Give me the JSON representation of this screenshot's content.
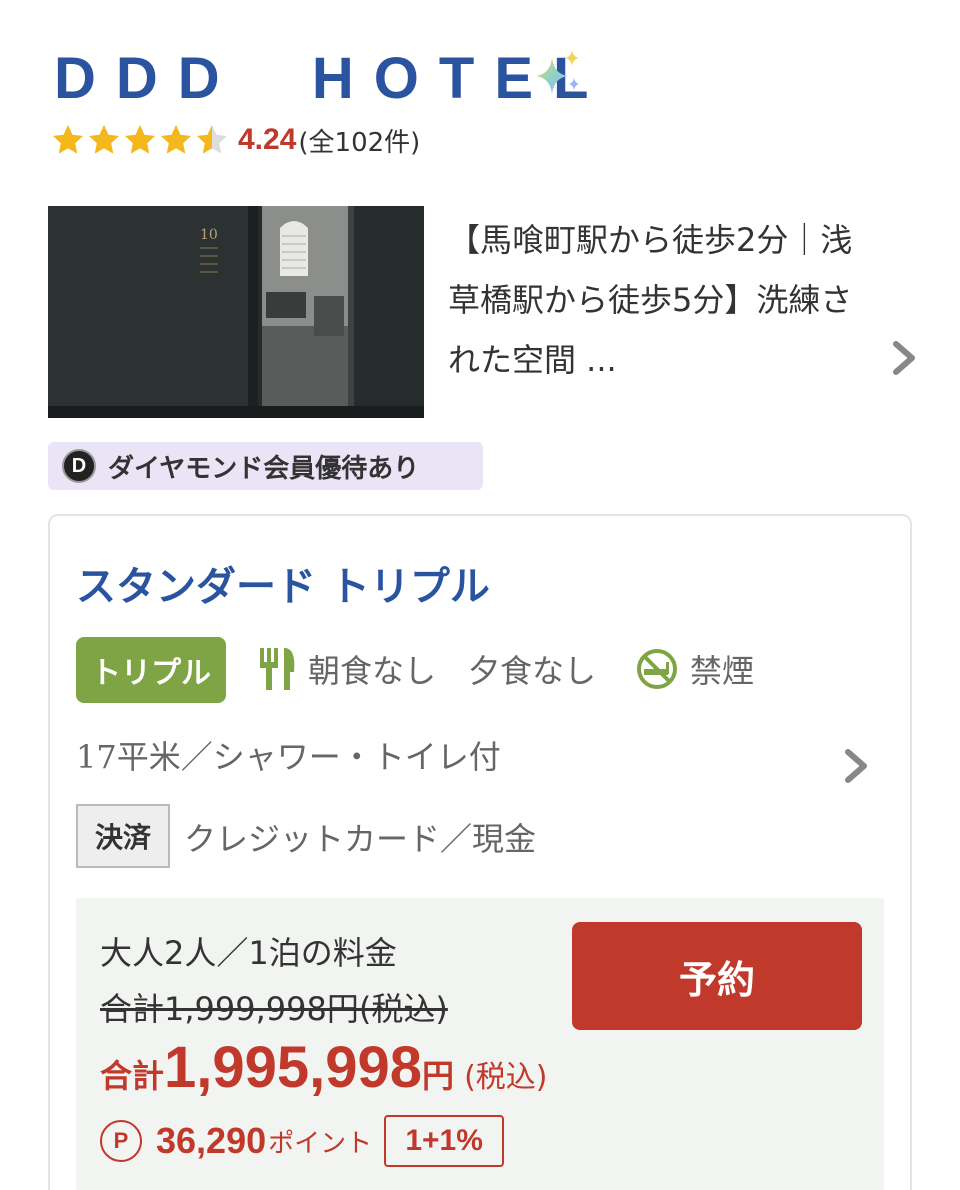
{
  "hotel": {
    "name": "DDD  HOTEL",
    "rating": "4.24",
    "review_count": "(全102件)",
    "rating_value": 4.24,
    "rating_max": 5
  },
  "listing": {
    "catchphrase": "【馬喰町駅から徒歩2分｜浅草橋駅から徒歩5分】洗練された空間 ...",
    "room_number_sign": "10"
  },
  "member_badge": {
    "icon_letter": "D",
    "label": "ダイヤモンド会員優待あり"
  },
  "room": {
    "name": "スタンダード トリプル",
    "type_badge": "トリプル",
    "meals": "朝食なし　夕食なし",
    "smoking": "禁煙",
    "spec": "17平米／シャワー・トイレ付",
    "payment_label": "決済",
    "payment_methods": "クレジットカード／現金"
  },
  "price": {
    "guests": "大人2人／1泊の料金",
    "original_total": "合計1,999,998円(税込)",
    "total_prefix": "合計",
    "total_amount": "1,995,998",
    "total_yen": "円",
    "total_tax": "(税込)",
    "points_icon": "P",
    "points": "36,290",
    "points_unit": "ポイント",
    "points_rate": "1+1%",
    "reserve_label": "予約"
  },
  "colors": {
    "title_blue": "#2a53a0",
    "accent_red": "#c0392b",
    "type_green": "#7ea445",
    "badge_purple": "#ebe4f7",
    "star_gold": "#f4b71c"
  },
  "icons": [
    "sparkle-icon",
    "star-icon",
    "chevron-right-icon",
    "diamond-member-icon",
    "cutlery-icon",
    "no-smoking-icon",
    "point-icon"
  ]
}
